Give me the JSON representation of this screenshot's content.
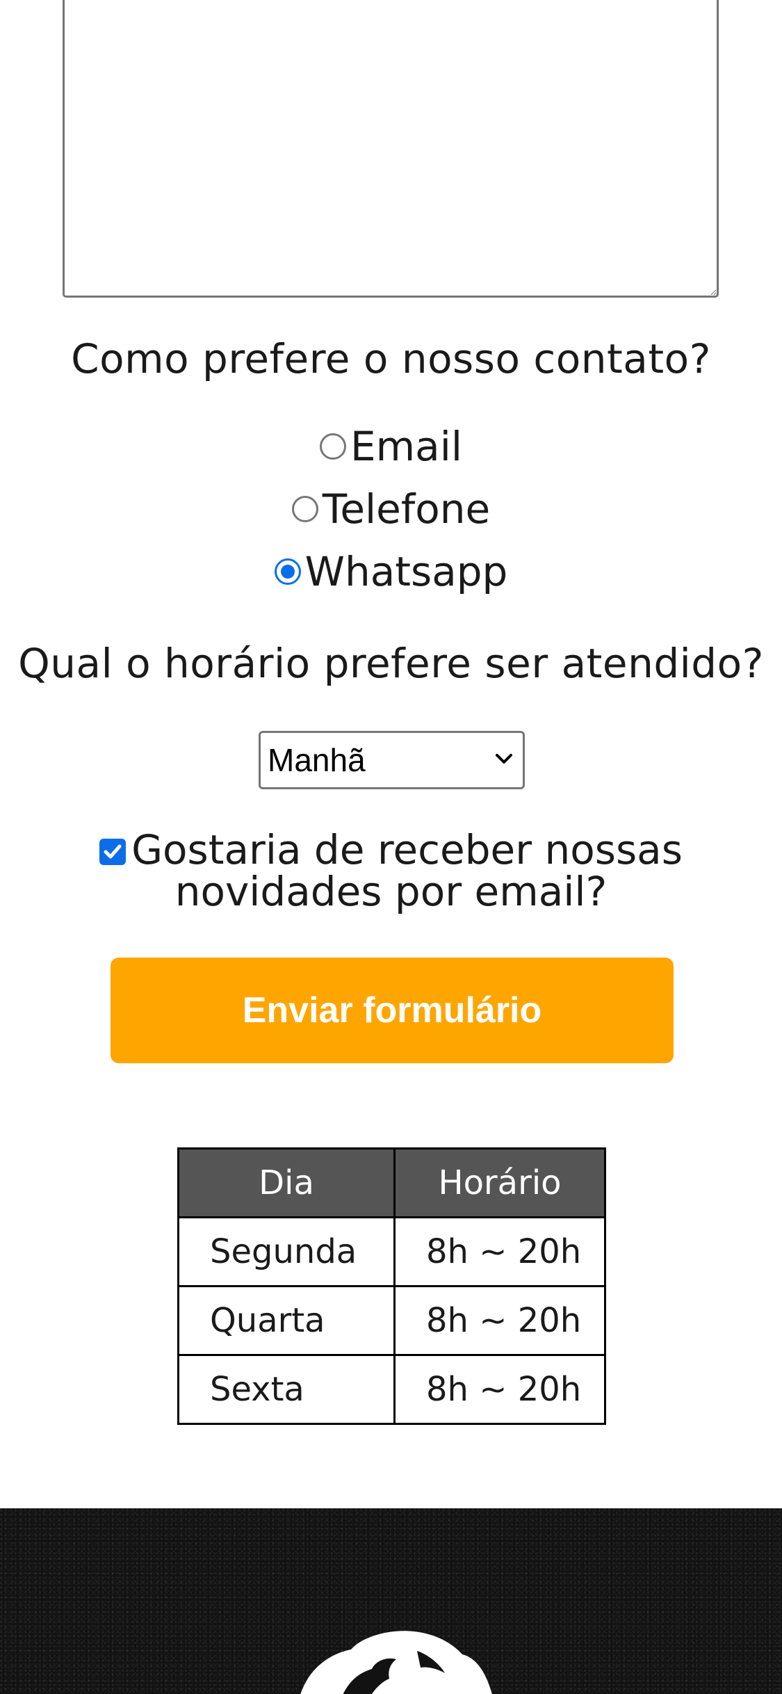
{
  "contact": {
    "question": "Como prefere o nosso contato?",
    "options": [
      {
        "label": "Email",
        "checked": false
      },
      {
        "label": "Telefone",
        "checked": false
      },
      {
        "label": "Whatsapp",
        "checked": true
      }
    ]
  },
  "schedule": {
    "question": "Qual o horário prefere ser atendido?",
    "selected": "Manhã"
  },
  "newsletter": {
    "checked": true,
    "line1": "Gostaria de receber nossas",
    "line2": "novidades por email?"
  },
  "submit": {
    "label": "Enviar formulário",
    "color": "#ffa500"
  },
  "hours_table": {
    "headers": [
      "Dia",
      "Horário"
    ],
    "rows": [
      [
        "Segunda",
        "8h ~ 20h"
      ],
      [
        "Quarta",
        "8h ~ 20h"
      ],
      [
        "Sexta",
        "8h ~ 20h"
      ]
    ]
  },
  "colors": {
    "accent": "#0b6ee8",
    "table_header": "#555555",
    "footer": "#121212"
  },
  "footer": {
    "logo_icon": "face-logo-icon"
  }
}
